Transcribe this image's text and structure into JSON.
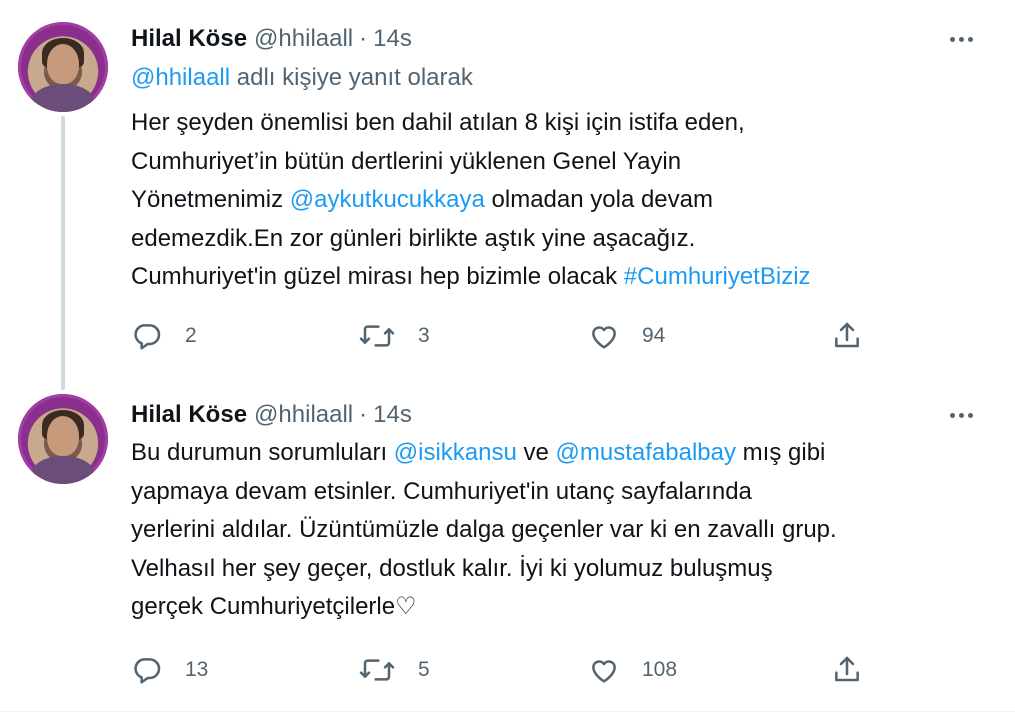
{
  "tweets": [
    {
      "author_name": "Hilal Köse",
      "author_handle": "@hhilaall",
      "separator": "·",
      "time": "14s",
      "reply_prefix_handle": "@hhilaall",
      "reply_suffix": " adlı kişiye yanıt olarak",
      "body": {
        "line1": "Her şeyden önemlisi ben dahil atılan 8 kişi için istifa eden,",
        "line2": "Cumhuriyet’in bütün dertlerini yüklenen Genel Yayin",
        "line3_a": "Yönetmenimiz ",
        "line3_mention": "@aykutkucukkaya",
        "line3_b": " olmadan yola devam",
        "line4": "edemezdik.En zor günleri birlikte aştık yine aşacağız.",
        "line5_a": "Cumhuriyet'in güzel mirası hep bizimle olacak ",
        "line5_hashtag": "#CumhuriyetBiziz"
      },
      "replies": "2",
      "retweets": "3",
      "likes": "94"
    },
    {
      "author_name": "Hilal Köse",
      "author_handle": "@hhilaall",
      "separator": "·",
      "time": "14s",
      "body": {
        "line1_a": "Bu durumun sorumluları ",
        "line1_mention1": "@isikkansu",
        "line1_b": " ve ",
        "line1_mention2": "@mustafabalbay",
        "line1_c": " mış gibi",
        "line2": "yapmaya devam etsinler. Cumhuriyet'in utanç sayfalarında",
        "line3": "yerlerini aldılar. Üzüntümüzle dalga geçenler var ki en zavallı grup.",
        "line4": "Velhasıl her şey geçer, dostluk kalır. İyi ki yolumuz buluşmuş",
        "line5": "gerçek Cumhuriyetçilerle♡"
      },
      "replies": "13",
      "retweets": "5",
      "likes": "108"
    }
  ],
  "icons": {
    "reply": "reply-icon",
    "retweet": "retweet-icon",
    "like": "heart-icon",
    "share": "share-icon",
    "more": "more-icon"
  },
  "colors": {
    "link": "#1d9bf0",
    "secondary_text": "#536471",
    "thread_line": "#cfd9de"
  }
}
